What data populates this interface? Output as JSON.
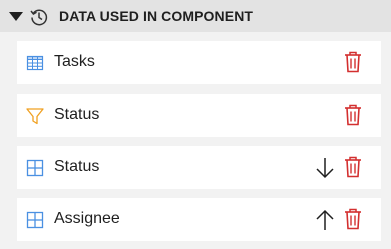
{
  "header": {
    "title": "DATA USED IN COMPONENT",
    "toggle_icon": "triangle-down-icon",
    "history_icon": "history-icon"
  },
  "colors": {
    "accent_blue": "#4a90e2",
    "filter_orange": "#f0a020",
    "delete_red": "#d32f2f"
  },
  "items": [
    {
      "label": "Tasks",
      "icon": "table-icon",
      "sort": "",
      "delete_icon": "trash-icon"
    },
    {
      "label": "Status",
      "icon": "filter-icon",
      "sort": "",
      "delete_icon": "trash-icon"
    },
    {
      "label": "Status",
      "icon": "grid-dimension-icon",
      "sort": "descending",
      "sort_icon": "arrow-down-icon",
      "delete_icon": "trash-icon"
    },
    {
      "label": "Assignee",
      "icon": "grid-dimension-icon",
      "sort": "ascending",
      "sort_icon": "arrow-up-icon",
      "delete_icon": "trash-icon"
    }
  ]
}
